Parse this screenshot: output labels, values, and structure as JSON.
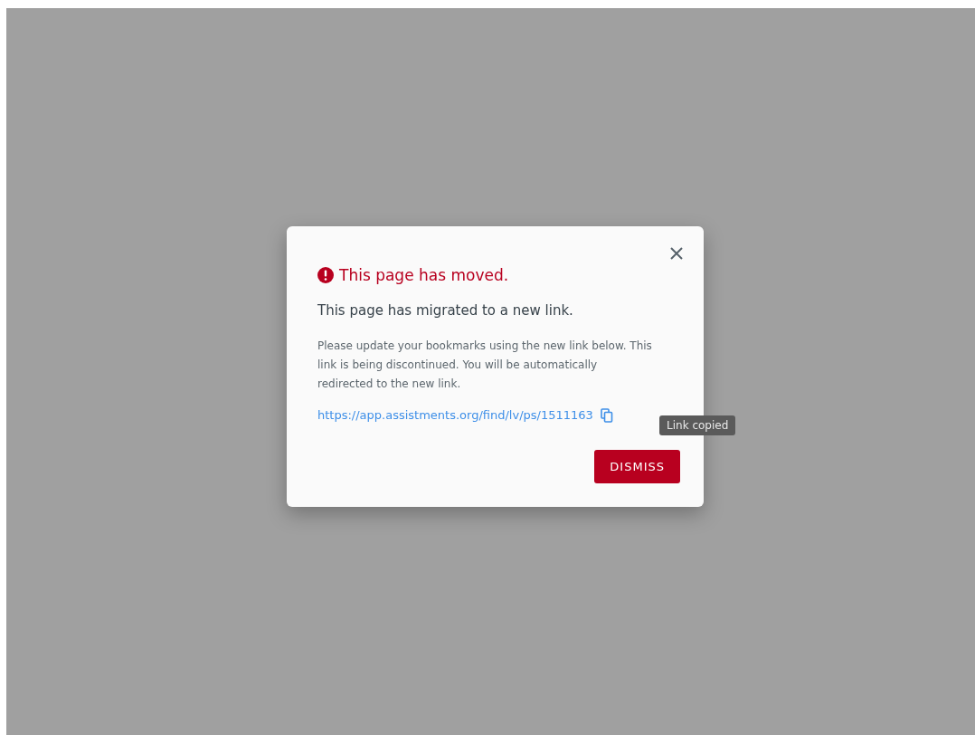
{
  "dialog": {
    "title": "This page has moved.",
    "subtitle": "This page has migrated to a new link.",
    "message": "Please update your bookmarks using the new link below. This link is being discontinued. You will be automatically redirected to the new link.",
    "link": "https://app.assistments.org/find/lv/ps/1511163",
    "tooltip": "Link copied",
    "button": "DISMISS"
  }
}
